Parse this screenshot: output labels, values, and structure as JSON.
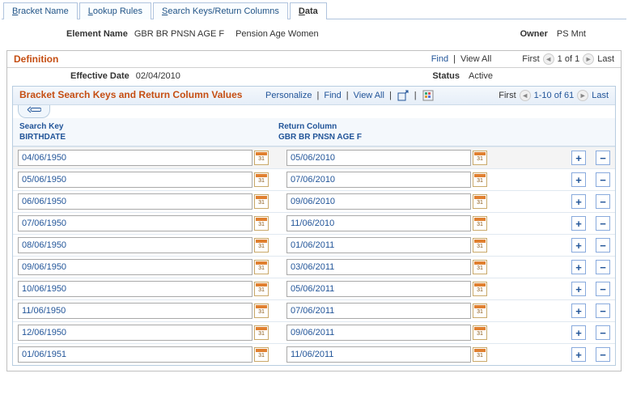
{
  "tabs": [
    {
      "label_pre": "",
      "ukey": "B",
      "label_post": "racket Name"
    },
    {
      "label_pre": "",
      "ukey": "L",
      "label_post": "ookup Rules"
    },
    {
      "label_pre": "",
      "ukey": "S",
      "label_post": "earch Keys/Return Columns"
    },
    {
      "label_pre": "",
      "ukey": "D",
      "label_post": "ata"
    }
  ],
  "header": {
    "element_name_label": "Element Name",
    "element_name_value": "GBR BR PNSN AGE F",
    "element_desc": "Pension Age Women",
    "owner_label": "Owner",
    "owner_value": "PS Mnt"
  },
  "definition": {
    "title": "Definition",
    "find": "Find",
    "view_all": "View All",
    "first": "First",
    "page": "1 of 1",
    "last": "Last",
    "eff_date_label": "Effective Date",
    "eff_date_value": "02/04/2010",
    "status_label": "Status",
    "status_value": "Active"
  },
  "grid": {
    "title": "Bracket Search Keys and Return Column Values",
    "personalize": "Personalize",
    "find": "Find",
    "view_all": "View All",
    "first": "First",
    "range": "1-10 of 61",
    "last": "Last",
    "col_search_key_l1": "Search Key",
    "col_search_key_l2": "BIRTHDATE",
    "col_return_l1": "Return Column",
    "col_return_l2": "GBR BR PNSN AGE F",
    "rows": [
      {
        "sk": "04/06/1950",
        "rc": "05/06/2010"
      },
      {
        "sk": "05/06/1950",
        "rc": "07/06/2010"
      },
      {
        "sk": "06/06/1950",
        "rc": "09/06/2010"
      },
      {
        "sk": "07/06/1950",
        "rc": "11/06/2010"
      },
      {
        "sk": "08/06/1950",
        "rc": "01/06/2011"
      },
      {
        "sk": "09/06/1950",
        "rc": "03/06/2011"
      },
      {
        "sk": "10/06/1950",
        "rc": "05/06/2011"
      },
      {
        "sk": "11/06/1950",
        "rc": "07/06/2011"
      },
      {
        "sk": "12/06/1950",
        "rc": "09/06/2011"
      },
      {
        "sk": "01/06/1951",
        "rc": "11/06/2011"
      }
    ]
  }
}
